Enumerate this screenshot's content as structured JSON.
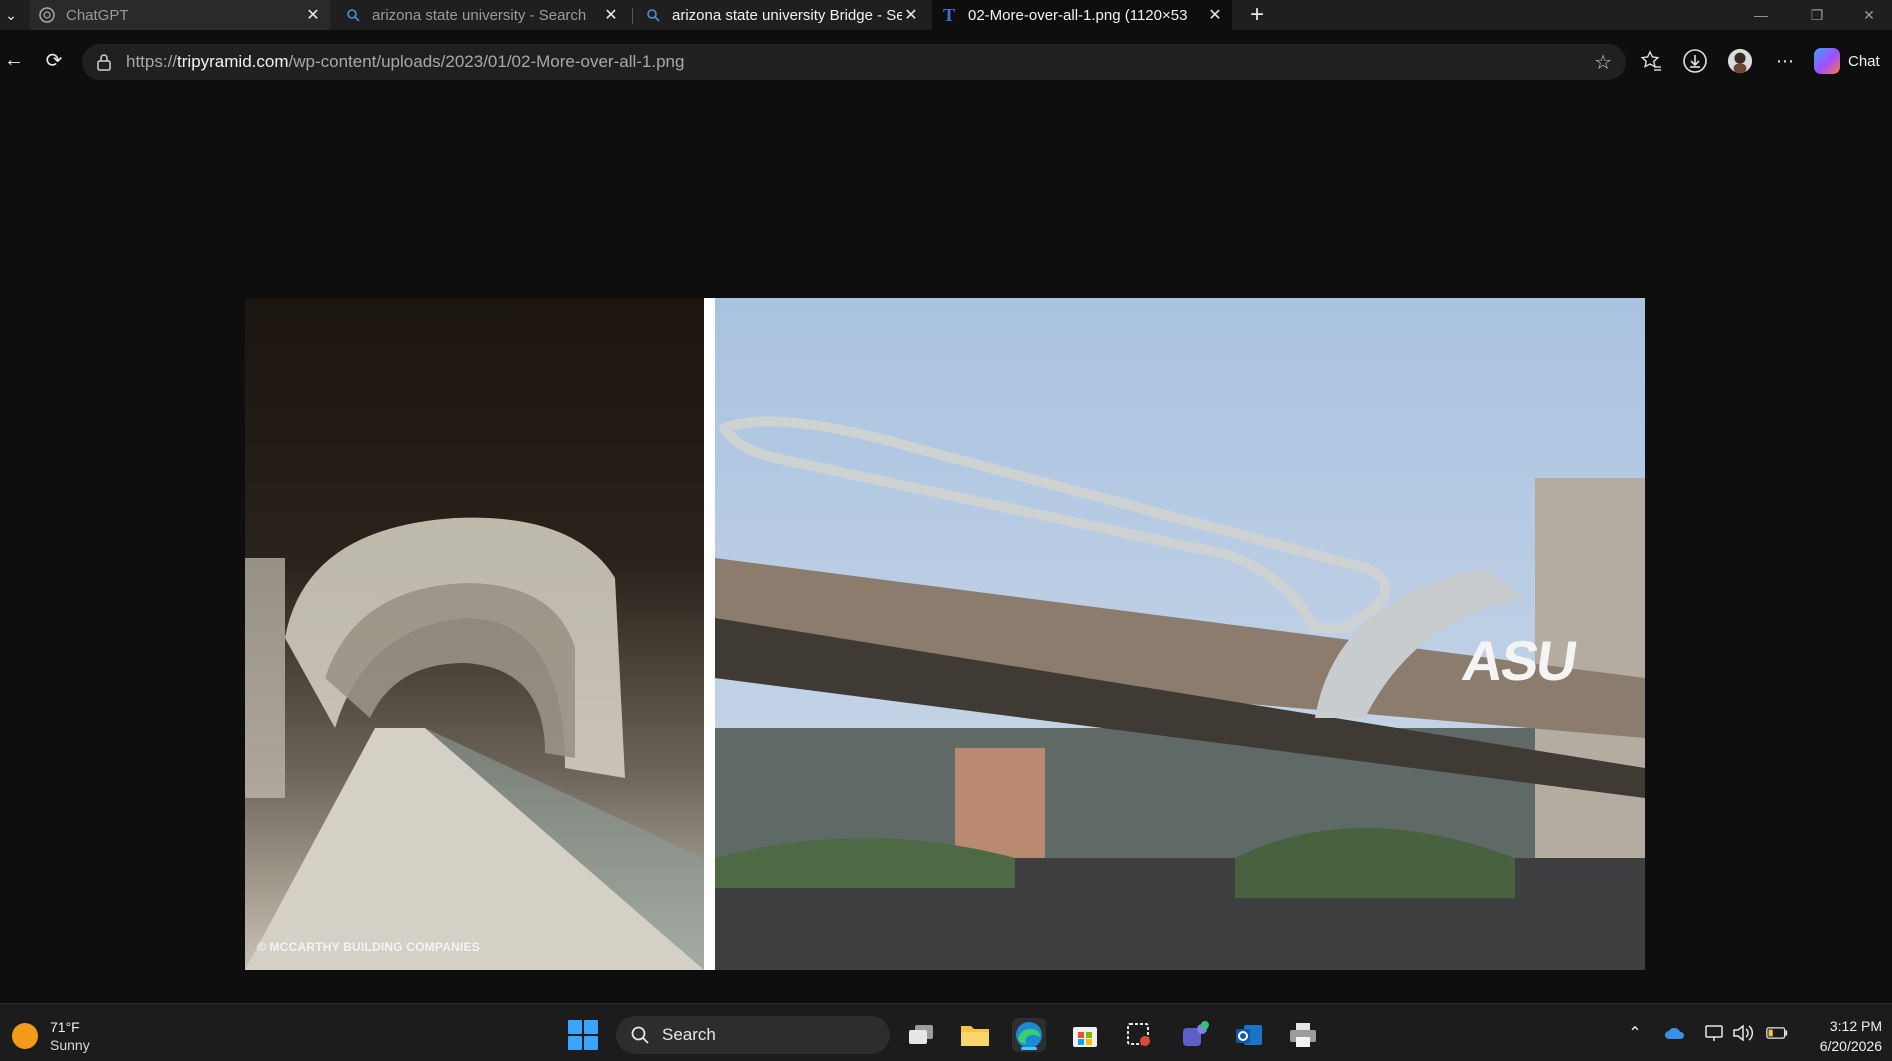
{
  "tabs": [
    {
      "title": "ChatGPT",
      "favicon": "chatgpt-icon",
      "active": false
    },
    {
      "title": "arizona state university - Search",
      "favicon": "search-icon",
      "active": false
    },
    {
      "title": "arizona state university Bridge - Se",
      "favicon": "search-icon",
      "active": false
    },
    {
      "title": "02-More-over-all-1.png (1120×53",
      "favicon": "tripyramid-icon",
      "active": true
    }
  ],
  "address_bar": {
    "url_prefix": "https://",
    "url_domain": "tripyramid.com",
    "url_path": "/wp-content/uploads/2023/01/02-More-over-all-1.png"
  },
  "toolbar": {
    "chat_label": "Chat"
  },
  "image": {
    "copyright_text": "© MCCARTHY BUILDING COMPANIES",
    "sign_text": "ASU"
  },
  "taskbar": {
    "weather_temp": "71°F",
    "weather_condition": "Sunny",
    "search_placeholder": "Search",
    "time": "3:12 PM",
    "date": "6/20/2026"
  },
  "colors": {
    "accent": "#4cc2ff",
    "start_blue": "#3aa5ff",
    "weather_sun": "#f39a19"
  }
}
